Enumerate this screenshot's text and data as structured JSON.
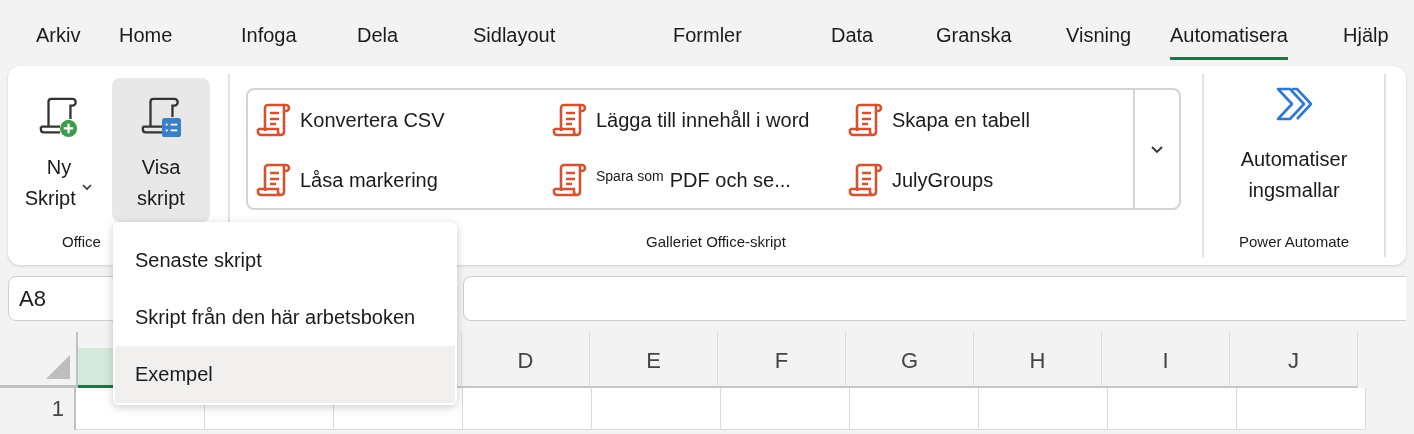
{
  "tabs": [
    {
      "label": "Arkiv",
      "selected": false
    },
    {
      "label": "Home",
      "selected": false
    },
    {
      "label": "Infoga",
      "selected": false
    },
    {
      "label": "Dela",
      "selected": false
    },
    {
      "label": "Sidlayout",
      "selected": false
    },
    {
      "label": "Formler",
      "selected": false
    },
    {
      "label": "Data",
      "selected": false
    },
    {
      "label": "Granska",
      "selected": false
    },
    {
      "label": "Visning",
      "selected": false
    },
    {
      "label": "Automatisera",
      "selected": true
    },
    {
      "label": "Hjälp",
      "selected": false
    }
  ],
  "office_group": {
    "buttons": [
      {
        "kind": "new",
        "label": "Ny",
        "label2": "Skript",
        "dropdown": true,
        "selected": false
      },
      {
        "kind": "view",
        "label": "Visa",
        "label2": "skript",
        "dropdown": false,
        "selected": true
      }
    ],
    "label": "Office"
  },
  "gallery": {
    "items": [
      {
        "label": "Konvertera CSV"
      },
      {
        "label": "Lägga till innehåll i word"
      },
      {
        "label": "Skapa en tabell"
      },
      {
        "label": "Låsa markering"
      },
      {
        "prefix": "Spara som",
        "label": "PDF och se..."
      },
      {
        "label": "JulyGroups"
      }
    ],
    "label": "Galleriet Office-skript"
  },
  "power_automate": {
    "button": {
      "label": "Automatiser",
      "label2": "ingsmallar"
    },
    "label": "Power Automate"
  },
  "name_box": {
    "value": "A8"
  },
  "columns": [
    {
      "selected": true
    },
    {
      "label": "D",
      "selected": false
    },
    {
      "label": "E",
      "selected": false
    },
    {
      "label": "F",
      "selected": false
    },
    {
      "label": "G",
      "selected": false
    },
    {
      "label": "H",
      "selected": false
    },
    {
      "label": "I",
      "selected": false
    },
    {
      "label": "J",
      "selected": false
    }
  ],
  "rows": [
    "1"
  ],
  "menu": {
    "items": [
      {
        "label": "Senaste skript",
        "selected": false
      },
      {
        "label": "Skript från den här arbetsboken",
        "selected": false
      },
      {
        "label": "Exempel",
        "selected": true
      }
    ]
  }
}
